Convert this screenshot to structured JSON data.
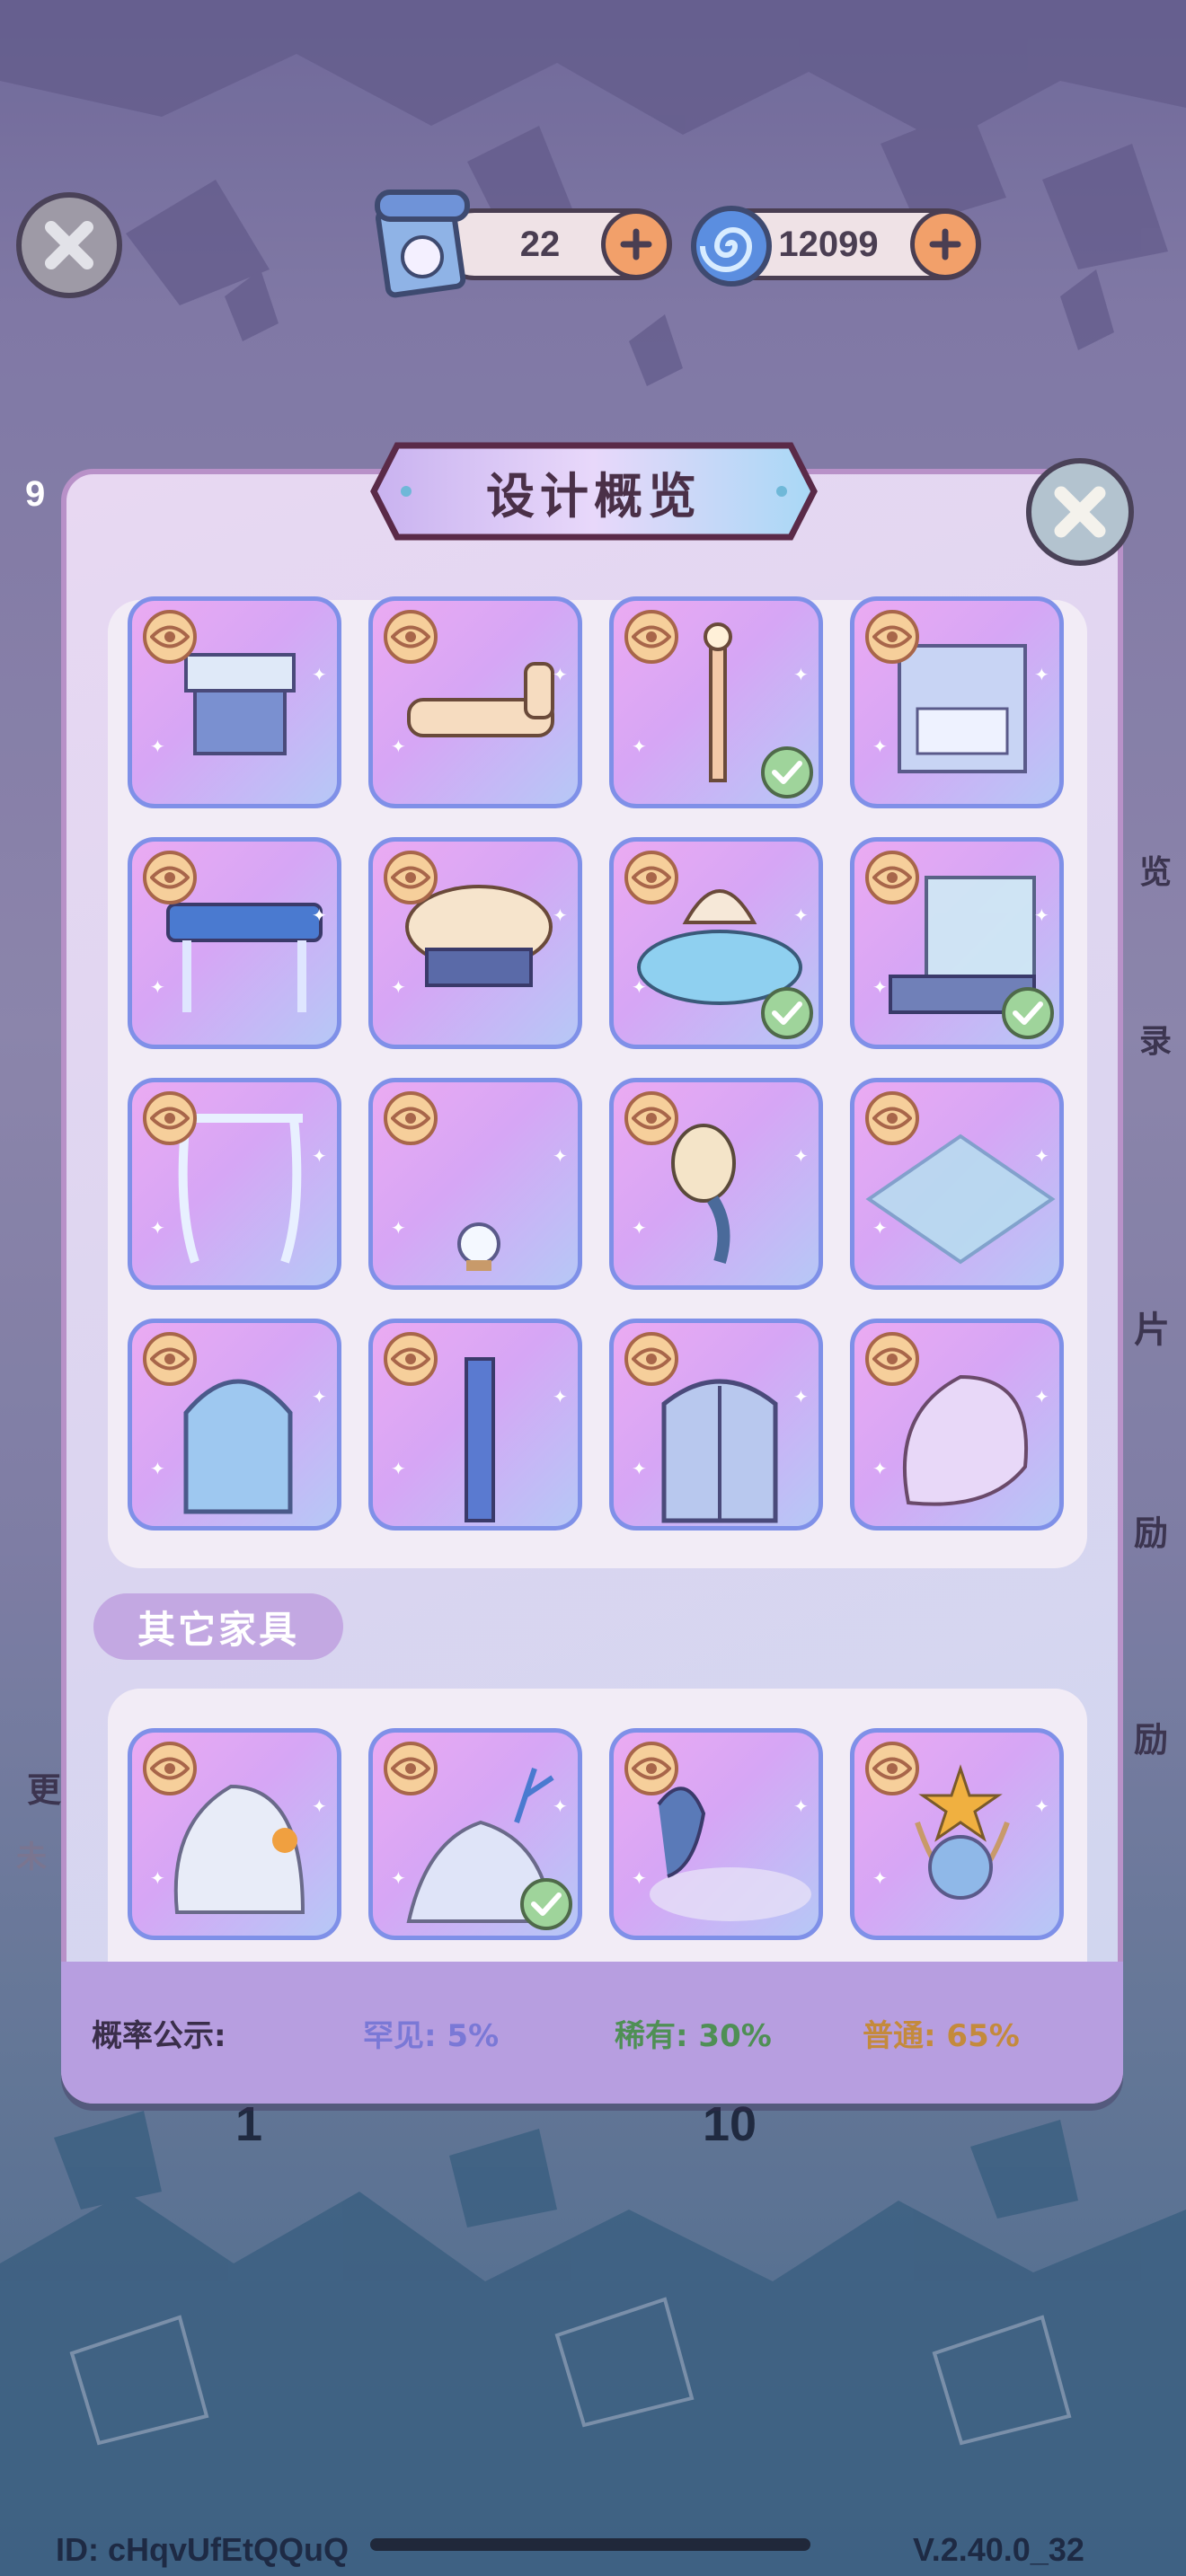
{
  "top_bar": {
    "scroll_count": "22",
    "gem_count": "12099"
  },
  "background": {
    "left_badge": "9",
    "right_text_1": "览",
    "right_text_2": "录",
    "right_text_3": "片",
    "right_text_4": "励",
    "right_text_5": "励",
    "left_text_1": "更",
    "left_text_2": "未",
    "button_count_1": "1",
    "button_count_10": "10"
  },
  "modal": {
    "title": "设计概览",
    "other_section_label": "其它家具",
    "probability": {
      "label": "概率公示:",
      "rare": "罕见: 5%",
      "uncommon": "稀有: 30%",
      "common": "普通: 65%"
    },
    "colors": {
      "rare": "#7a78d6",
      "uncommon": "#4f8f55",
      "common": "#c48a3c"
    }
  },
  "set_items": [
    {
      "name": "side-table",
      "owned": false
    },
    {
      "name": "chaise-lounge",
      "owned": false
    },
    {
      "name": "floor-lamp",
      "owned": true
    },
    {
      "name": "canopy-bed",
      "owned": false
    },
    {
      "name": "writing-desk",
      "owned": false
    },
    {
      "name": "round-stool",
      "owned": false
    },
    {
      "name": "shell-bathtub",
      "owned": true
    },
    {
      "name": "aquarium-cabinet",
      "owned": true
    },
    {
      "name": "curtain-arch",
      "owned": false
    },
    {
      "name": "crystal-ball",
      "owned": false
    },
    {
      "name": "shell-lamp",
      "owned": false
    },
    {
      "name": "glass-rug",
      "owned": false
    },
    {
      "name": "arched-window",
      "owned": false
    },
    {
      "name": "tall-mirror",
      "owned": false
    },
    {
      "name": "double-door",
      "owned": false
    },
    {
      "name": "conch-chair",
      "owned": false
    }
  ],
  "other_items": [
    {
      "name": "rock-decoration",
      "owned": false
    },
    {
      "name": "coral-rock",
      "owned": true
    },
    {
      "name": "whale-decoration",
      "owned": false
    },
    {
      "name": "starfish-basket",
      "owned": false
    }
  ],
  "footer": {
    "id": "ID: cHqvUfEtQQuQ",
    "version": "V.2.40.0_32"
  }
}
